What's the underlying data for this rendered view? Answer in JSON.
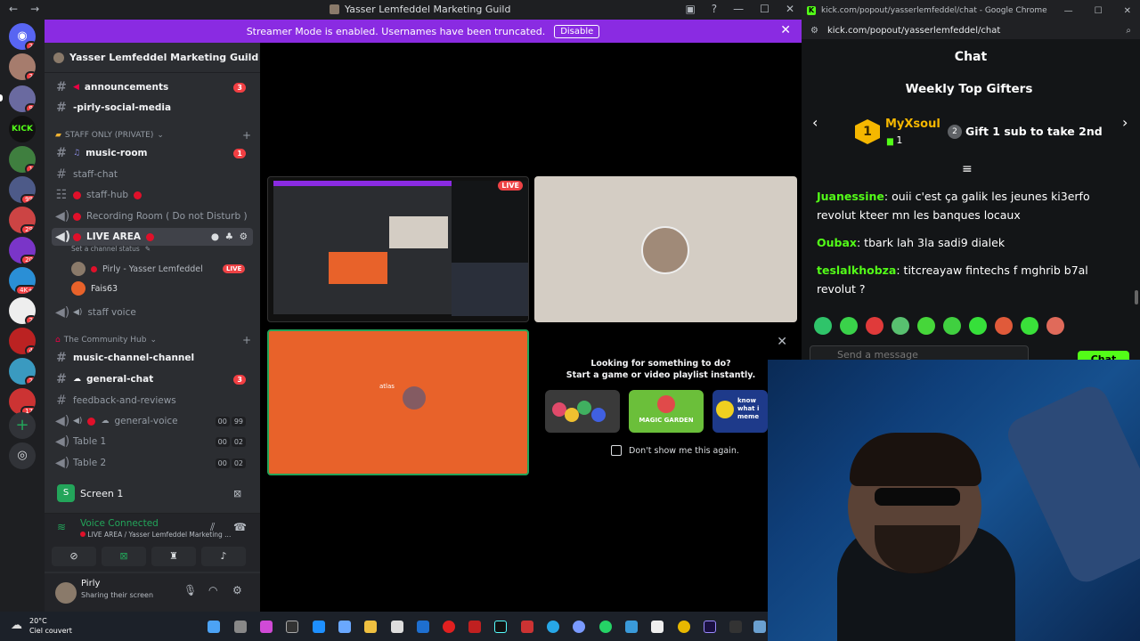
{
  "discord": {
    "window_title": "Yasser Lemfeddel Marketing Guild",
    "streamer_banner": {
      "text": "Streamer Mode is enabled. Usernames have been truncated.",
      "button": "Disable"
    },
    "server_name": "Yasser Lemfeddel Marketing Guild",
    "guild_badges": [
      "2",
      "2",
      "9",
      "1",
      "1",
      "99",
      "29",
      "20",
      "4K+",
      "2",
      "4",
      "2",
      "17"
    ],
    "channels": {
      "announcements": {
        "label": "announcements",
        "count": "3"
      },
      "social": {
        "label": "-pirly-social-media"
      },
      "staff_category": "STAFF ONLY (PRIVATE)",
      "music_room": {
        "label": "music-room",
        "count": "1"
      },
      "staff_chat": {
        "label": "staff-chat"
      },
      "staff_hub": {
        "label": "staff-hub"
      },
      "recording_room": {
        "label": "Recording Room ( Do not Disturb )"
      },
      "live_area": {
        "label": "LIVE AREA",
        "status_hint": "Set a channel status"
      },
      "live_user": {
        "name": "Pirly - Yasser Lemfeddel",
        "badge": "LIVE"
      },
      "second_user": {
        "name": "Fais63"
      },
      "staff_voice": {
        "label": "staff voice"
      },
      "community_category": "The Community Hub",
      "music_channel": {
        "label": "music-channel-channel"
      },
      "general_chat": {
        "label": "general-chat",
        "count": "3"
      },
      "feedback": {
        "label": "feedback-and-reviews"
      },
      "general_voice": {
        "label": "general-voice",
        "users_a": "00",
        "users_b": "99"
      },
      "table1": {
        "label": "Table 1",
        "users_a": "00",
        "users_b": "02"
      },
      "table2": {
        "label": "Table 2",
        "users_a": "00",
        "users_b": "02"
      }
    },
    "screen_row": "Screen 1",
    "voice": {
      "status": "Voice Connected",
      "location": "LIVE AREA / Yasser Lemfeddel Marketing ..."
    },
    "user": {
      "name": "Pirly",
      "status": "Sharing their screen"
    },
    "activity": {
      "line1": "Looking for something to do?",
      "line2": "Start a game or video playlist instantly.",
      "dont_show": "Don't show me this again.",
      "cards": [
        "MAGIC GARDEN",
        "know what i meme"
      ]
    },
    "orange_tile_text": "atlas",
    "mini_live": "LIVE"
  },
  "chrome": {
    "title": "kick.com/popout/yasserlemfeddel/chat - Google Chrome",
    "url": "kick.com/popout/yasserlemfeddel/chat",
    "chat_title": "Chat",
    "gifters_title": "Weekly Top Gifters",
    "top_gifter": {
      "rank": "1",
      "name": "MyXsoul",
      "count": "1"
    },
    "second": {
      "rank": "2",
      "cta": "Gift 1 sub to take 2nd"
    },
    "messages": [
      {
        "user": "Juanessine",
        "color": "#53fc18",
        "text": " ouii c'est ça galik les jeunes ki3erfo revolut kteer mn les banques locaux"
      },
      {
        "user": "Oubax",
        "color": "#53fc18",
        "text": " tbark lah 3la sadi9 dialek"
      },
      {
        "user": "teslalkhobza",
        "color": "#53fc18",
        "text": " titcreayaw fintechs f mghrib b7al revolut ?"
      }
    ],
    "input_placeholder": "Send a message",
    "send_button": "Chat"
  },
  "taskbar": {
    "temp": "20°C",
    "weather": "Ciel couvert"
  }
}
